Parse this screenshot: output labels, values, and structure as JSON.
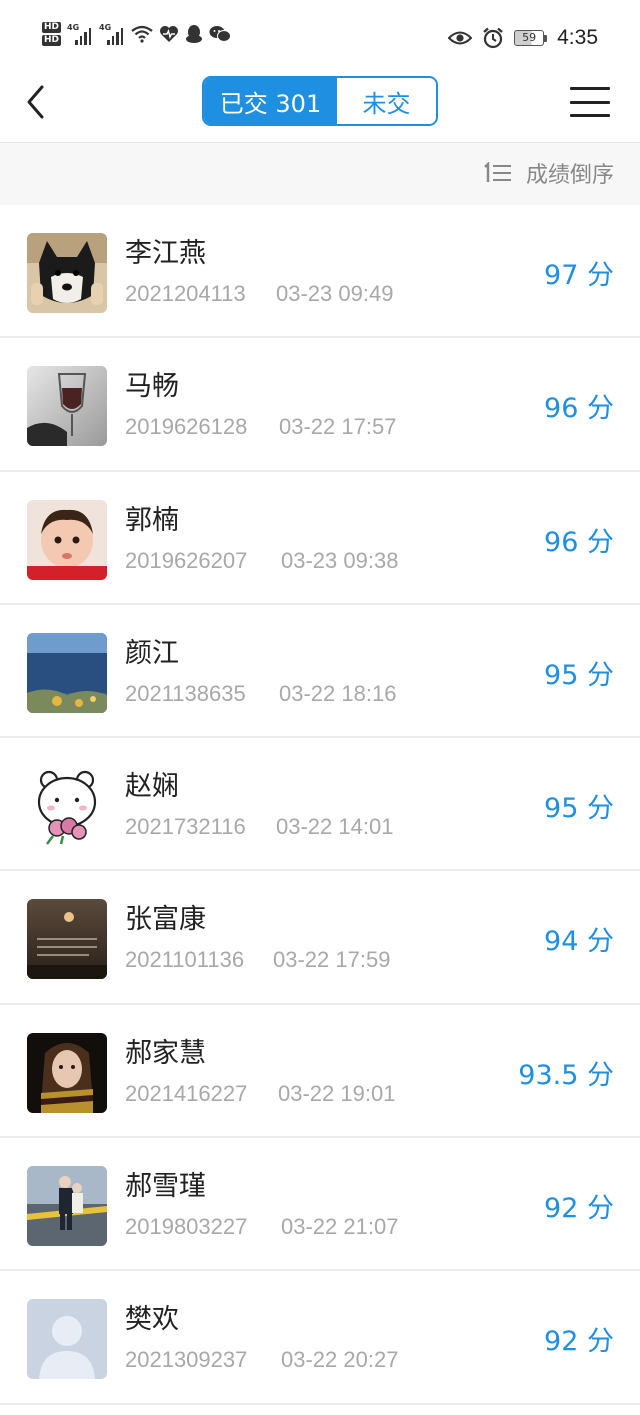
{
  "status_bar": {
    "hd1": "HD",
    "hd2": "HD",
    "net1": "4G",
    "net2": "4G",
    "battery": "59",
    "time": "4:35"
  },
  "nav": {
    "tab_submitted": "已交 301",
    "tab_unsubmitted": "未交"
  },
  "sort": {
    "label": "成绩倒序"
  },
  "students": [
    {
      "name": "李江燕",
      "id": "2021204113",
      "time": "03-23 09:49",
      "score": "97 分"
    },
    {
      "name": "马畅",
      "id": "2019626128",
      "time": "03-22 17:57",
      "score": "96 分"
    },
    {
      "name": "郭楠",
      "id": "2019626207",
      "time": "03-23 09:38",
      "score": "96 分"
    },
    {
      "name": "颜江",
      "id": "2021138635",
      "time": "03-22 18:16",
      "score": "95 分"
    },
    {
      "name": "赵娴",
      "id": "2021732116",
      "time": "03-22 14:01",
      "score": "95 分"
    },
    {
      "name": "张富康",
      "id": "2021101136",
      "time": "03-22 17:59",
      "score": "94 分"
    },
    {
      "name": "郝家慧",
      "id": "2021416227",
      "time": "03-22 19:01",
      "score": "93.5 分"
    },
    {
      "name": "郝雪瑾",
      "id": "2019803227",
      "time": "03-22 21:07",
      "score": "92 分"
    },
    {
      "name": "樊欢",
      "id": "2021309237",
      "time": "03-22 20:27",
      "score": "92 分"
    }
  ],
  "icons": {
    "back": "chevron-left-icon",
    "menu": "menu-icon",
    "sort": "sort-desc-icon"
  },
  "colors": {
    "accent": "#1e8fe1"
  }
}
